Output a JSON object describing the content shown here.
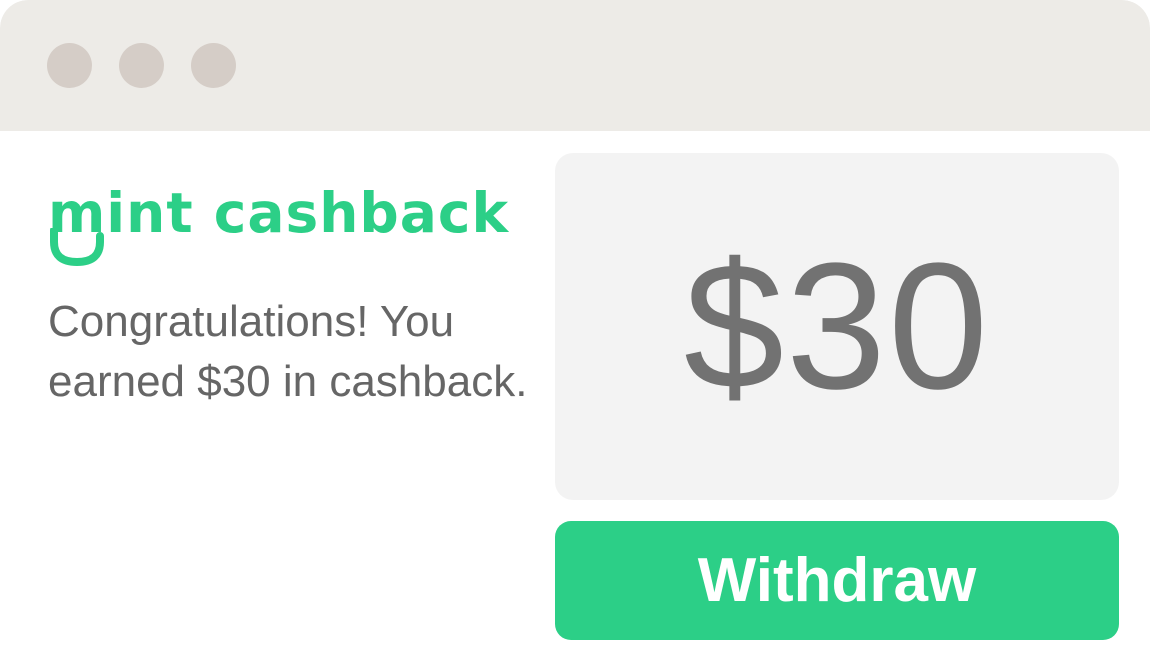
{
  "window": {
    "controls": [
      "close-dot",
      "minimize-dot",
      "maximize-dot"
    ]
  },
  "brand": {
    "logo_text": "mint cashback",
    "color": "#2ccf87"
  },
  "message": {
    "text": "Congratulations! You earned $30 in cashback."
  },
  "cashback": {
    "amount": "$30"
  },
  "actions": {
    "withdraw_label": "Withdraw"
  },
  "colors": {
    "accent": "#2ccf87",
    "text": "#666666",
    "amount_text": "#727272",
    "card_bg": "#f3f3f3",
    "titlebar_bg": "#edebe7",
    "dot": "#d5cdc7"
  }
}
